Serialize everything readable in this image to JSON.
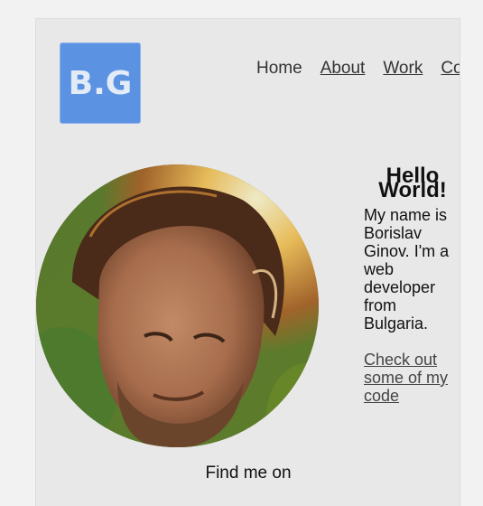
{
  "logo": {
    "text": "B.G"
  },
  "nav": {
    "home": "Home",
    "about": "About",
    "work": "Work",
    "contact": "Contact"
  },
  "hero": {
    "heading": "Hello World!",
    "bio": "My name is Borislav Ginov. I'm a web developer from Bulgaria.",
    "code_link": "Check out some of my code"
  },
  "footer": {
    "find_me": "Find me on"
  },
  "colors": {
    "page_background": "#f2f2f2",
    "card_background": "#e8e8e8",
    "logo_background": "#5b93e2",
    "text": "#111111",
    "link": "#333333"
  },
  "icons": {
    "profile_photo": "portrait-photo"
  }
}
